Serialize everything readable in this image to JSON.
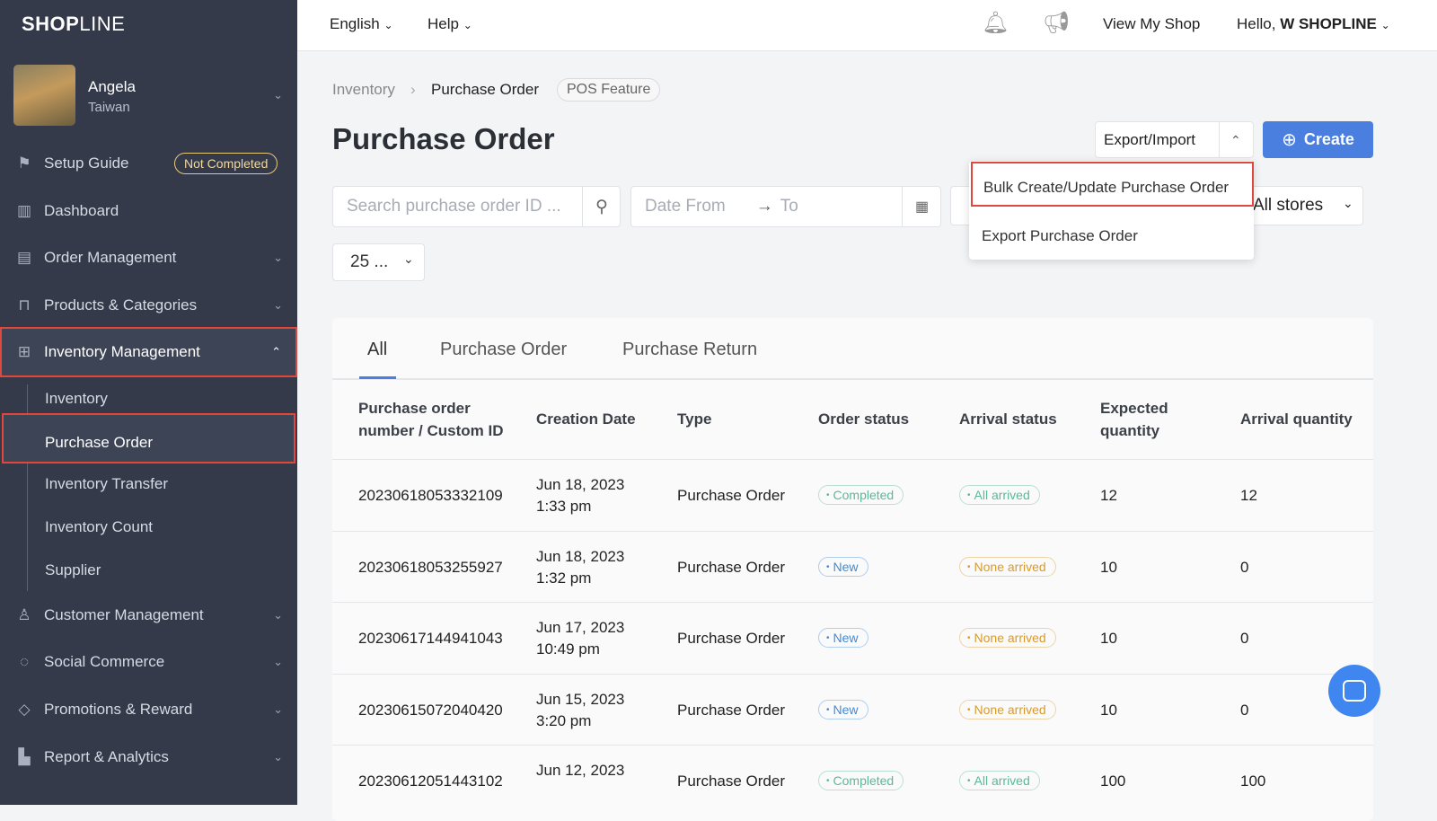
{
  "brand": {
    "logo": "SHOPLINE"
  },
  "user": {
    "name": "Angela",
    "region": "Taiwan"
  },
  "sidebar": {
    "setup_guide": {
      "label": "Setup Guide",
      "badge": "Not Completed"
    },
    "items": [
      {
        "label": "Dashboard",
        "icon": "dashboard-icon"
      },
      {
        "label": "Order Management",
        "icon": "order-icon"
      },
      {
        "label": "Products & Categories",
        "icon": "bag-icon"
      },
      {
        "label": "Inventory Management",
        "icon": "inventory-icon"
      },
      {
        "label": "Customer Management",
        "icon": "user-icon"
      },
      {
        "label": "Social Commerce",
        "icon": "chat-icon"
      },
      {
        "label": "Promotions & Reward",
        "icon": "tag-icon"
      },
      {
        "label": "Report & Analytics",
        "icon": "chart-icon"
      }
    ],
    "subitems": [
      "Inventory",
      "Purchase Order",
      "Inventory Transfer",
      "Inventory Count",
      "Supplier"
    ]
  },
  "topbar": {
    "language": "English",
    "help": "Help",
    "view_shop": "View My Shop",
    "hello": "Hello,",
    "shop_name": "W SHOPLINE"
  },
  "breadcrumb": {
    "parent": "Inventory",
    "current": "Purchase Order",
    "tag": "POS Feature"
  },
  "page": {
    "title": "Purchase Order"
  },
  "toolbar": {
    "export_import": "Export/Import",
    "create": "Create",
    "search_placeholder": "Search purchase order ID ...",
    "date_from": "Date From",
    "date_to": "To",
    "stores": "All stores",
    "page_size": "25 ..."
  },
  "dropdown": {
    "items": [
      "Bulk Create/Update Purchase Order",
      "Export Purchase Order"
    ]
  },
  "tabs": [
    "All",
    "Purchase Order",
    "Purchase Return"
  ],
  "table": {
    "headers": [
      "Purchase order number / Custom ID",
      "Creation Date",
      "Type",
      "Order status",
      "Arrival status",
      "Expected quantity",
      "Arrival quantity"
    ],
    "rows": [
      {
        "id": "20230618053332109",
        "date": "Jun 18, 2023",
        "time": "1:33 pm",
        "type": "Purchase Order",
        "status": "Completed",
        "arrival": "All arrived",
        "expected": "12",
        "arrived": "12"
      },
      {
        "id": "20230618053255927",
        "date": "Jun 18, 2023",
        "time": "1:32 pm",
        "type": "Purchase Order",
        "status": "New",
        "arrival": "None arrived",
        "expected": "10",
        "arrived": "0"
      },
      {
        "id": "20230617144941043",
        "date": "Jun 17, 2023",
        "time": "10:49 pm",
        "type": "Purchase Order",
        "status": "New",
        "arrival": "None arrived",
        "expected": "10",
        "arrived": "0"
      },
      {
        "id": "20230615072040420",
        "date": "Jun 15, 2023",
        "time": "3:20 pm",
        "type": "Purchase Order",
        "status": "New",
        "arrival": "None arrived",
        "expected": "10",
        "arrived": "0"
      },
      {
        "id": "20230612051443102",
        "date": "Jun 12, 2023",
        "time": "",
        "type": "Purchase Order",
        "status": "Completed",
        "arrival": "All arrived",
        "expected": "100",
        "arrived": "100"
      }
    ]
  },
  "colors": {
    "sidebar": "#343a4a",
    "primary": "#4a7fe0",
    "highlight": "#e0483c",
    "completed": "#5bb89a",
    "new": "#3f8ad8",
    "none": "#d99a2b"
  }
}
